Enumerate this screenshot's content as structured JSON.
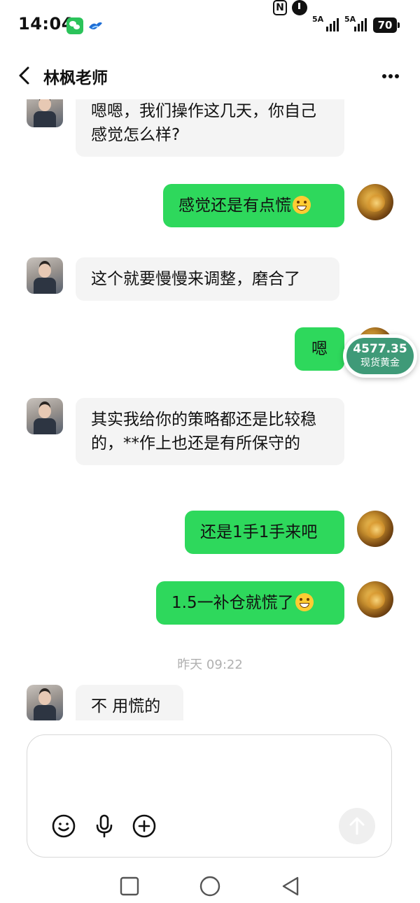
{
  "status_bar": {
    "time": "14:04",
    "nfc_label": "N",
    "signal_1": "5A",
    "signal_2": "5A",
    "battery": "70"
  },
  "header": {
    "title": "林枫老师",
    "back_icon": "chevron-left-icon",
    "more_icon": "more-dots-icon"
  },
  "messages": [
    {
      "from": "teacher",
      "text": "嗯嗯，我们操作这几天，你自己感觉怎么样?"
    },
    {
      "from": "user",
      "text": "感觉还是有点慌",
      "emoji": "grin-emoji"
    },
    {
      "from": "teacher",
      "text": "这个就要慢慢来调整，磨合了"
    },
    {
      "from": "user",
      "text": "嗯"
    },
    {
      "from": "teacher",
      "text": "其实我给你的策略都还是比较稳的，**作上也还是有所保守的"
    },
    {
      "from": "user",
      "text": "还是1手1手来吧"
    },
    {
      "from": "user",
      "text": "1.5一补仓就慌了",
      "emoji": "grin-emoji"
    },
    {
      "from": "teacher",
      "text": "不 用慌的"
    }
  ],
  "timestamp": "昨天 09:22",
  "gold_widget": {
    "price": "4577.35",
    "label": "现货黄金"
  },
  "input": {
    "value": "",
    "placeholder": ""
  },
  "toolbar": {
    "emoji_icon": "smiley-icon",
    "voice_icon": "microphone-icon",
    "add_icon": "plus-circle-icon",
    "send_icon": "arrow-up-icon"
  },
  "colors": {
    "outgoing_bubble": "#2ed85c",
    "incoming_bubble": "#f4f4f4",
    "gold_widget": "#3f9a78"
  }
}
